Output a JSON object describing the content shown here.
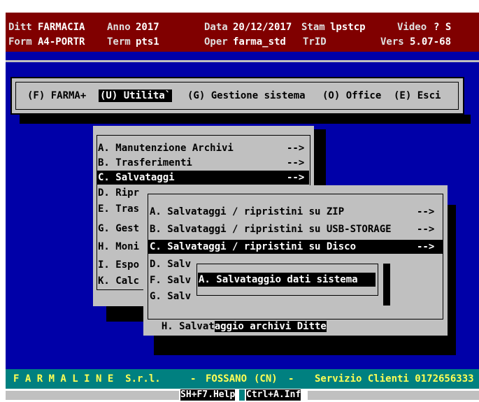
{
  "header": {
    "line1": {
      "ditt_label": "Ditt",
      "ditt_value": "FARMACIA",
      "anno_label": "Anno",
      "anno_value": "2017",
      "data_label": "Data",
      "data_value": "20/12/2017",
      "stam_label": "Stam",
      "stam_value": "lpstcp",
      "video_label": "Video",
      "video_value": "? S"
    },
    "line2": {
      "form_label": "Form",
      "form_value": "A4-PORTR",
      "term_label": "Term",
      "term_value": "pts1",
      "oper_label": "Oper",
      "oper_value": "farma_std",
      "trid_label": "TrID",
      "vers_label": "Vers",
      "vers_value": "5.07-68"
    }
  },
  "main_menu": {
    "items": [
      {
        "label": "(F) FARMA+"
      },
      {
        "label": "(U) Utilita`",
        "selected": true
      },
      {
        "label": "(G) Gestione sistema"
      },
      {
        "label": "(O) Office"
      },
      {
        "label": "(E) Esci"
      }
    ]
  },
  "utilita_menu": {
    "items": [
      {
        "label": "A. Manutenzione Archivi",
        "arrow": "-->"
      },
      {
        "label": "B. Trasferimenti",
        "arrow": "-->"
      },
      {
        "label": "C. Salvataggi",
        "arrow": "-->",
        "selected": true
      },
      {
        "label": "D. Ripr"
      },
      {
        "label": "E. Tras"
      },
      {
        "label": "G. Gest"
      },
      {
        "label": "H. Moni"
      },
      {
        "label": "I. Espo"
      },
      {
        "label": "K. Calc"
      }
    ]
  },
  "salvataggi_menu": {
    "items": [
      {
        "label": "A. Salvataggi / ripristini su ZIP",
        "arrow": "-->"
      },
      {
        "label": "B. Salvataggi / ripristini su USB-STORAGE",
        "arrow": "-->"
      },
      {
        "label": "C. Salvataggi / ripristini su Disco",
        "arrow": "-->",
        "selected": true
      },
      {
        "label": "D. Salv"
      },
      {
        "label": "F. Salv"
      },
      {
        "label": "G. Salv"
      },
      {
        "label": "H. Salvat",
        "tail": "aggio archivi Ditte"
      }
    ]
  },
  "disco_menu": {
    "items": [
      {
        "label": "A. Salvataggio dati sistema",
        "selected": true
      }
    ]
  },
  "footer": {
    "company": "F A R M A L I N E  S.r.l.",
    "sep1": "-",
    "city": "FOSSANO",
    "province": "(CN)",
    "sep2": "-",
    "service": "Servizio Clienti 0172656333"
  },
  "helpbar": {
    "help": "SH+F7.Help",
    "info": "Ctrl+A.Inf"
  },
  "colors": {
    "header_bg": "#800000",
    "screen_bg": "#0000a8",
    "menu_bg": "#c0c0c0",
    "footer_bg": "#008080",
    "footer_text": "#ffff55"
  }
}
